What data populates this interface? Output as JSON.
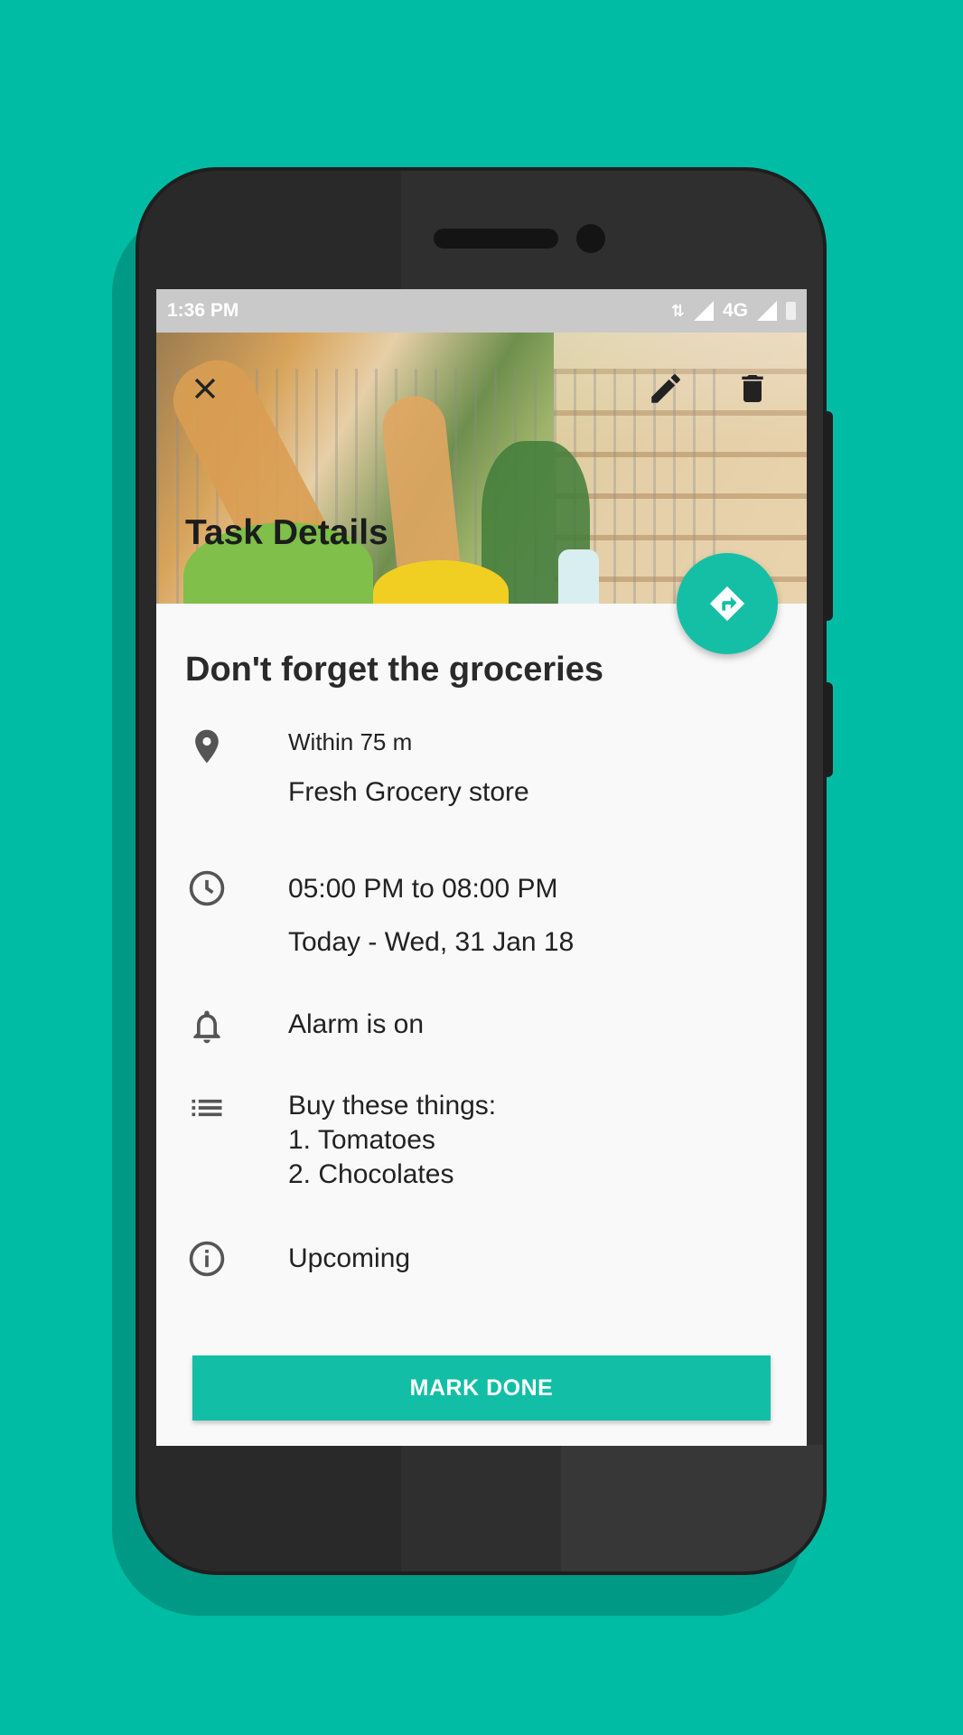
{
  "status_bar": {
    "time": "1:36 PM",
    "network": "4G",
    "data_icon": "data-transfer-icon",
    "signal_icon": "signal-icon",
    "battery_icon": "battery-icon"
  },
  "header": {
    "title": "Task Details",
    "close_icon": "close-icon",
    "edit_icon": "pencil-icon",
    "delete_icon": "trash-icon",
    "fab_icon": "directions-icon"
  },
  "task": {
    "title": "Don't forget the groceries",
    "location": {
      "icon": "location-pin-icon",
      "radius": "Within 75 m",
      "place": "Fresh Grocery store"
    },
    "time": {
      "icon": "clock-icon",
      "range": "05:00 PM to 08:00 PM",
      "date": "Today - Wed, 31 Jan 18"
    },
    "alarm": {
      "icon": "bell-icon",
      "text": "Alarm is on"
    },
    "notes": {
      "icon": "list-icon",
      "lines": [
        "Buy these things:",
        "1. Tomatoes",
        "2. Chocolates"
      ]
    },
    "status": {
      "icon": "info-icon",
      "text": "Upcoming"
    }
  },
  "actions": {
    "mark_done": "MARK DONE"
  },
  "colors": {
    "background": "#00bca4",
    "accent": "#12bea5",
    "phone_body": "#2f2f2f"
  }
}
